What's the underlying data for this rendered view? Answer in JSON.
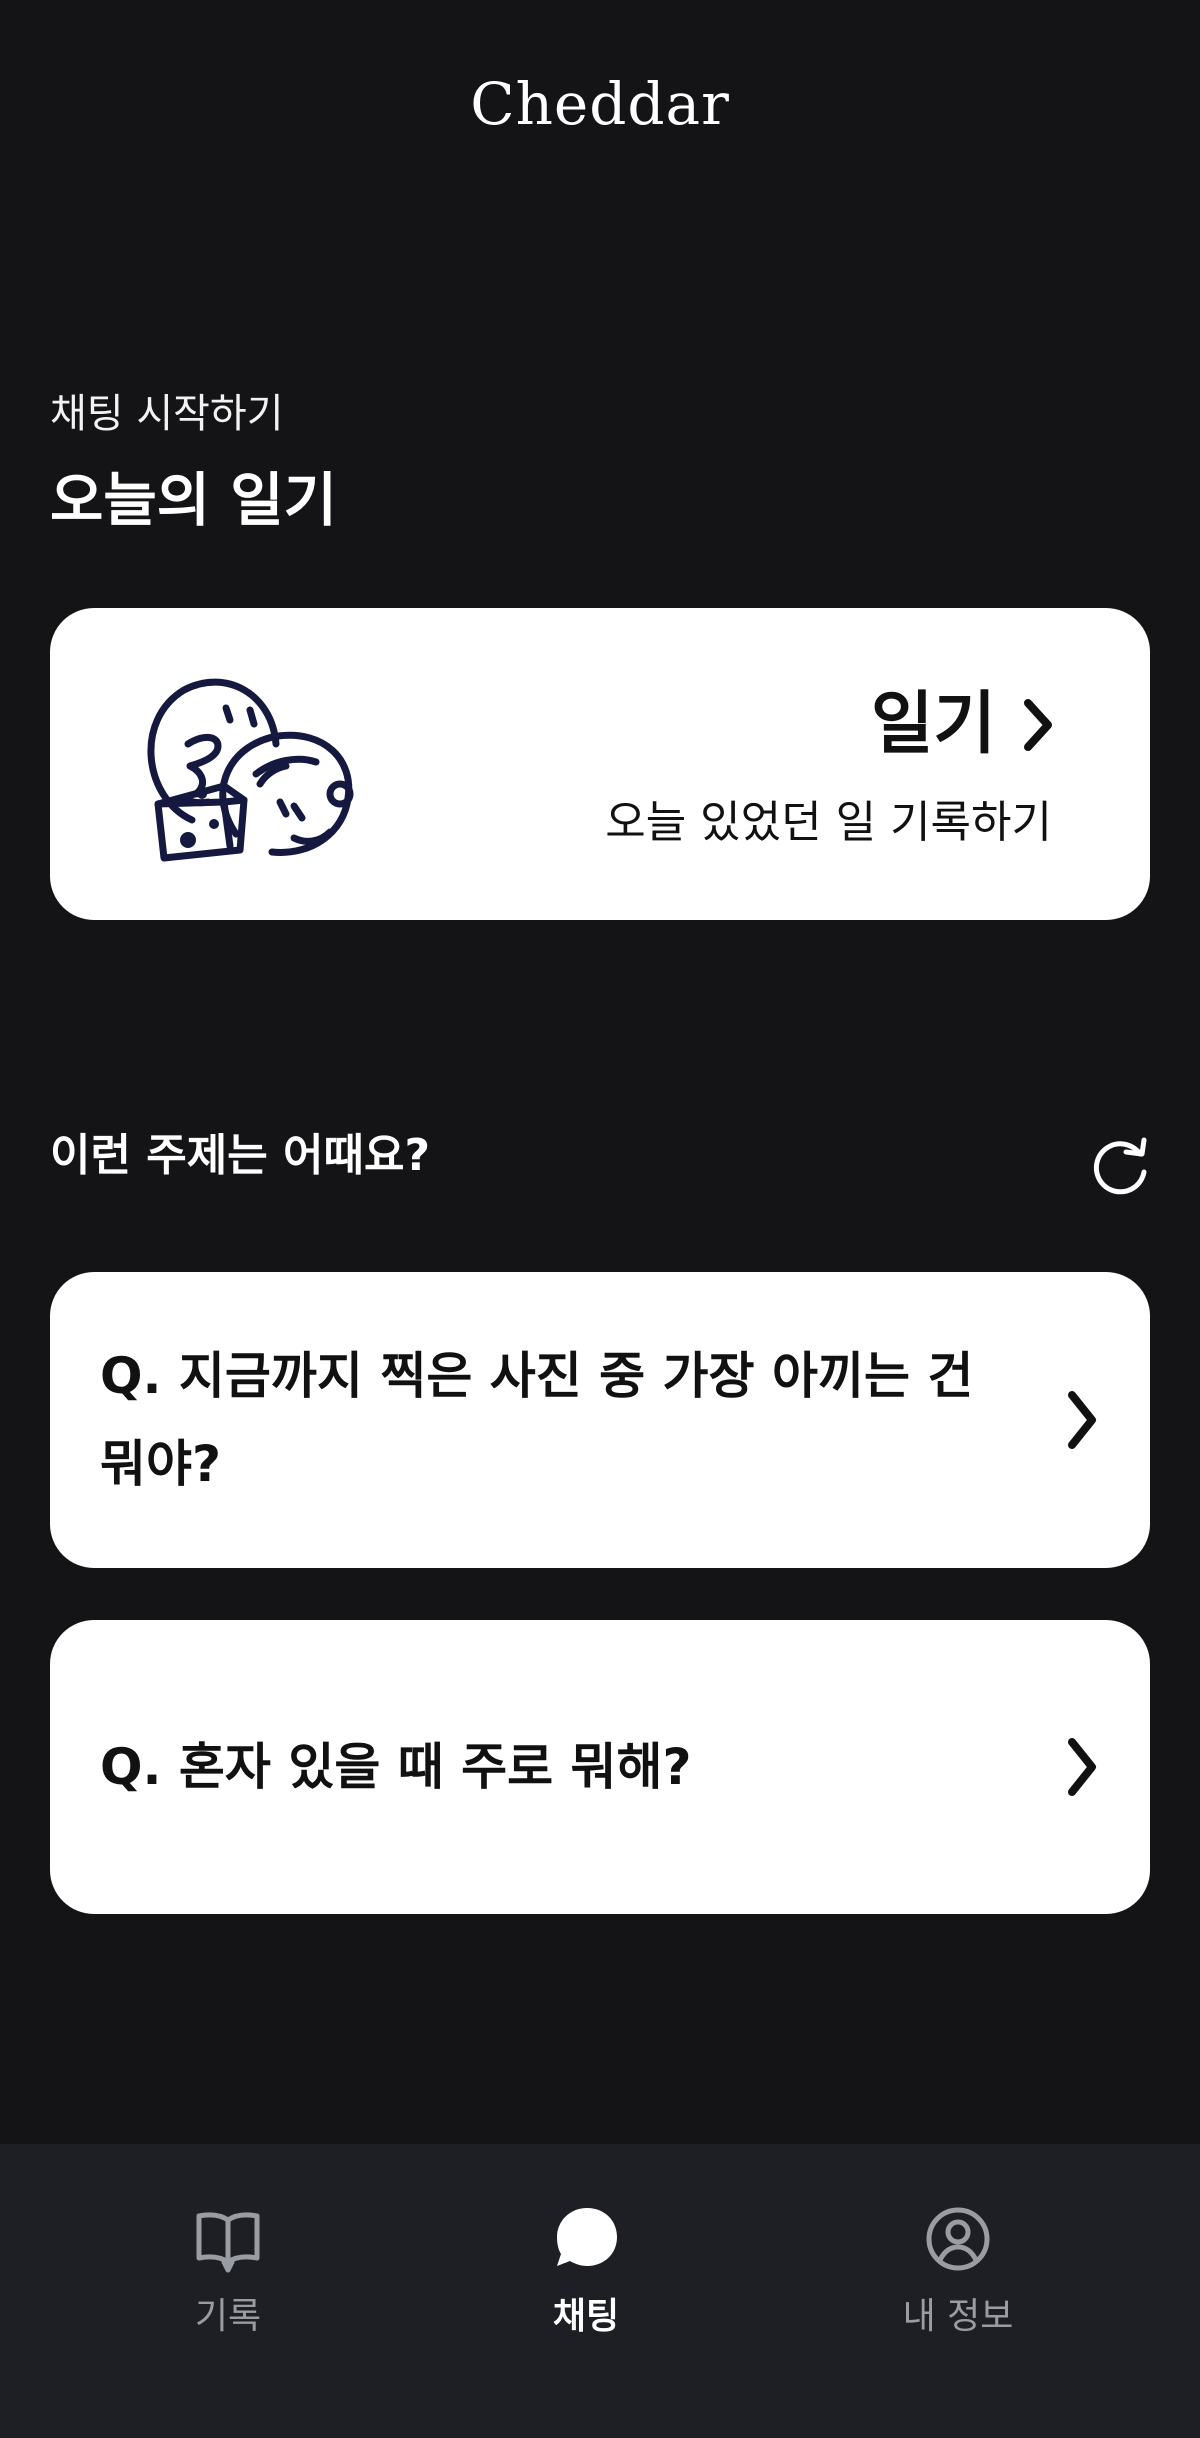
{
  "app": {
    "title": "Cheddar"
  },
  "header": {
    "subtitle": "채팅 시작하기",
    "title": "오늘의 일기"
  },
  "diary_card": {
    "title": "일기",
    "description": "오늘 있었던 일 기록하기",
    "illustration": "faces-and-cheese-illustration",
    "chevron_icon": "chevron-right-icon"
  },
  "topics": {
    "title": "이런 주제는 어때요?",
    "refresh_icon": "refresh-icon",
    "questions": [
      {
        "text": "Q. 지금까지 찍은 사진 중 가장 아끼는 건 뭐야?"
      },
      {
        "text": "Q. 혼자 있을 때 주로 뭐해?"
      }
    ]
  },
  "bottom_nav": {
    "items": [
      {
        "label": "기록",
        "icon": "book-icon",
        "active": false
      },
      {
        "label": "채팅",
        "icon": "chat-bubble-icon",
        "active": true
      },
      {
        "label": "내 정보",
        "icon": "profile-icon",
        "active": false
      }
    ]
  },
  "colors": {
    "background": "#141416",
    "card": "#ffffff",
    "nav_background": "#1d1f24",
    "nav_inactive": "#9a9ca3",
    "nav_active": "#ffffff",
    "illustration_stroke": "#15193f",
    "text_dark": "#111111"
  }
}
